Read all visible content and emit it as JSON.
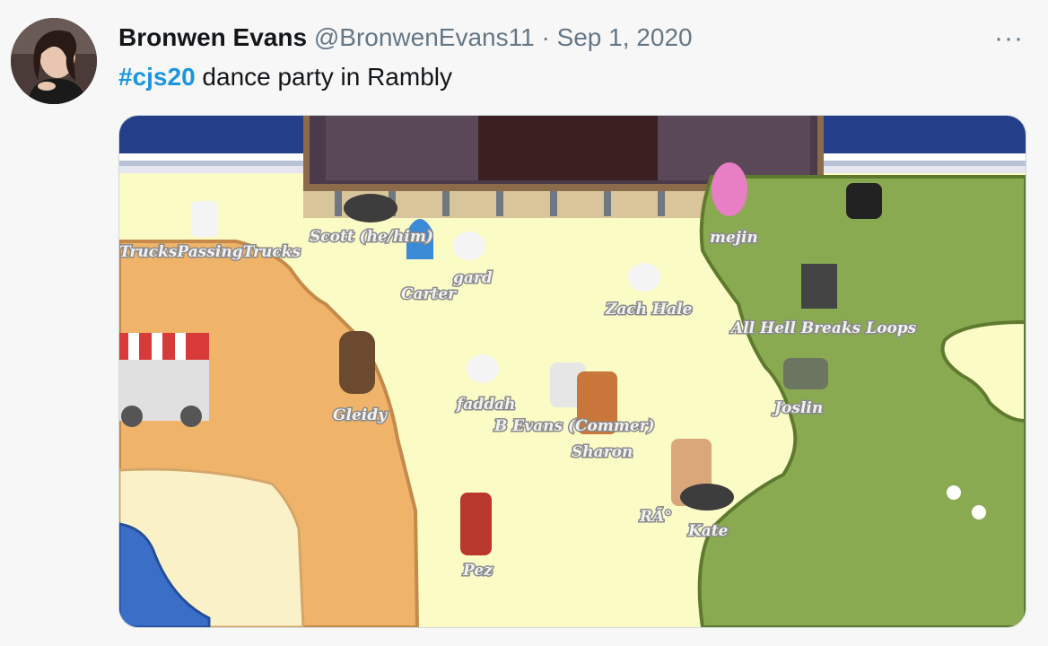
{
  "tweet": {
    "author_name": "Bronwen Evans",
    "handle": "@BronwenEvans11",
    "separator": "·",
    "date": "Sep 1, 2020",
    "more_icon": "···",
    "hashtag": "#cjs20",
    "body_text": " dance party in Rambly"
  },
  "media": {
    "labels": {
      "trucks": "TrucksPassingTrucks",
      "scott": "Scott (he/him)",
      "carter": "Carter",
      "gard": "gard",
      "mejin": "mejin",
      "zach": "Zach Hale",
      "allhell": "All Hell Breaks Loops",
      "gleidy": "Gleidy",
      "faddah": "faddah",
      "bevans": "B Evans (Commer)",
      "sharon": "Sharon",
      "joslin": "Joslin",
      "rac": "RÃ°",
      "kate": "Kate",
      "pez": "Pez"
    }
  },
  "colors": {
    "hashtag": "#1b95e0",
    "grass": "#8aaa52",
    "sand": "#efb469",
    "path": "#fbfbc6",
    "water": "#3b6ec7",
    "sky": "#243e8a"
  }
}
